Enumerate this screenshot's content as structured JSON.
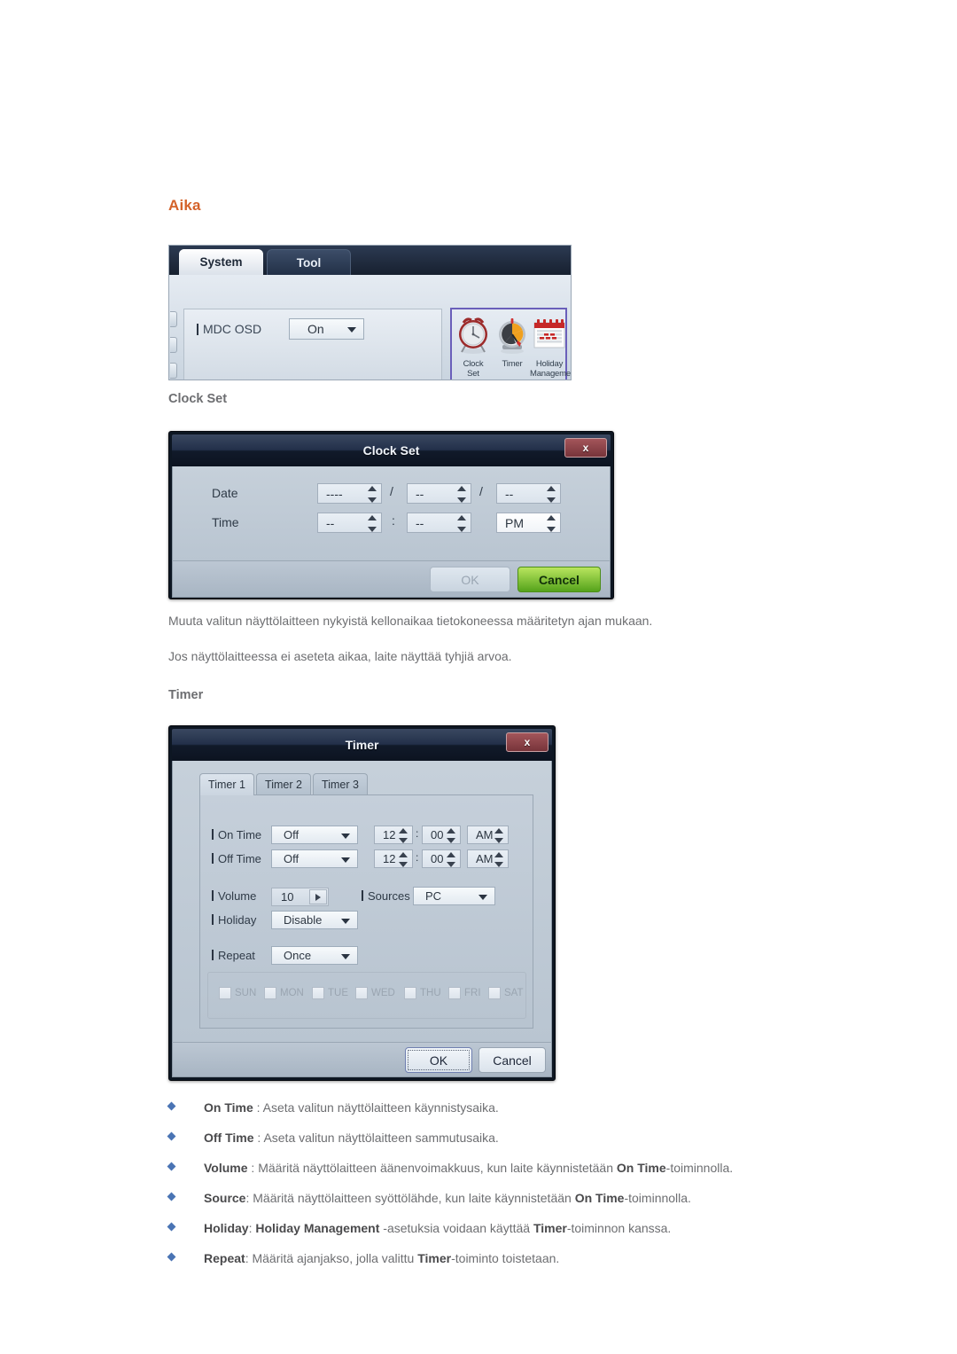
{
  "page": {
    "section_heading": "Aika",
    "accent_color": "#d4622a",
    "bullet_color": "#4a74b4"
  },
  "headings": {
    "clock_set": "Clock Set",
    "timer": "Timer"
  },
  "paragraphs": {
    "p1": "Muuta valitun näyttölaitteen nykyistä kellonaikaa tietokoneessa määritetyn ajan mukaan.",
    "p2": "Jos näyttölaitteessa ei aseteta aikaa, laite näyttää tyhjiä arvoa."
  },
  "mdc_panel": {
    "tabs": [
      {
        "label": "System",
        "active": true
      },
      {
        "label": "Tool",
        "active": false
      }
    ],
    "osd": {
      "label": "MDC OSD",
      "value": "On"
    },
    "icons": [
      {
        "name": "clock-set-icon",
        "caption_line1": "Clock",
        "caption_line2": "Set"
      },
      {
        "name": "timer-icon",
        "caption_line1": "Timer",
        "caption_line2": ""
      },
      {
        "name": "holiday-management-icon",
        "caption_line1": "Holiday",
        "caption_line2": "Management"
      }
    ],
    "selection_border_color": "#6a5fba"
  },
  "clock_set_dialog": {
    "title": "Clock Set",
    "close_label": "x",
    "rows": [
      {
        "label": "Date",
        "fields": [
          "----",
          "--",
          "--"
        ],
        "separators": [
          "/",
          "/"
        ]
      },
      {
        "label": "Time",
        "fields": [
          "--",
          "--",
          "PM"
        ],
        "separators": [
          ":"
        ]
      }
    ],
    "buttons": {
      "ok": "OK",
      "cancel": "Cancel"
    }
  },
  "timer_dialog": {
    "title": "Timer",
    "close_label": "x",
    "tabs": [
      {
        "label": "Timer 1",
        "active": true
      },
      {
        "label": "Timer 2",
        "active": false
      },
      {
        "label": "Timer 3",
        "active": false
      }
    ],
    "fields": {
      "on_time": {
        "label": "On Time",
        "mode": "Off",
        "hour": "12",
        "minute": "00",
        "meridiem": "AM",
        "separator": ":"
      },
      "off_time": {
        "label": "Off Time",
        "mode": "Off",
        "hour": "12",
        "minute": "00",
        "meridiem": "AM",
        "separator": ":"
      },
      "volume": {
        "label": "Volume",
        "value": "10"
      },
      "sources": {
        "label": "Sources",
        "value": "PC"
      },
      "holiday": {
        "label": "Holiday",
        "value": "Disable"
      },
      "repeat": {
        "label": "Repeat",
        "value": "Once"
      }
    },
    "days": [
      {
        "label": "SUN",
        "checked": false
      },
      {
        "label": "MON",
        "checked": false
      },
      {
        "label": "TUE",
        "checked": false
      },
      {
        "label": "WED",
        "checked": false
      },
      {
        "label": "THU",
        "checked": false
      },
      {
        "label": "FRI",
        "checked": false
      },
      {
        "label": "SAT",
        "checked": false
      }
    ],
    "buttons": {
      "ok": "OK",
      "cancel": "Cancel"
    }
  },
  "bullets": [
    {
      "term": "On Time",
      "sep": " : ",
      "text_before": "Aseta valitun näyttölaitteen käynnistysaika.",
      "term2": "",
      "text_after": ""
    },
    {
      "term": "Off Time",
      "sep": " : ",
      "text_before": "Aseta valitun näyttölaitteen sammutusaika.",
      "term2": "",
      "text_after": ""
    },
    {
      "term": "Volume",
      "sep": " : ",
      "text_before": "Määritä näyttölaitteen äänenvoimakkuus, kun laite käynnistetään ",
      "term2": "On Time",
      "text_after": "-toiminnolla."
    },
    {
      "term": "Source",
      "sep": ": ",
      "text_before": "Määritä näyttölaitteen syöttölähde, kun laite käynnistetään ",
      "term2": "On Time",
      "text_after": "-toiminnolla."
    },
    {
      "term": "Holiday",
      "sep": ": ",
      "text_before": "",
      "term2": "Holiday Management",
      "text_after": " -asetuksia voidaan käyttää ",
      "term3": "Timer",
      "text_end": "-toiminnon kanssa."
    },
    {
      "term": "Repeat",
      "sep": ": ",
      "text_before": "Määritä ajanjakso, jolla valittu ",
      "term2": "Timer",
      "text_after": "-toiminto toistetaan."
    }
  ]
}
